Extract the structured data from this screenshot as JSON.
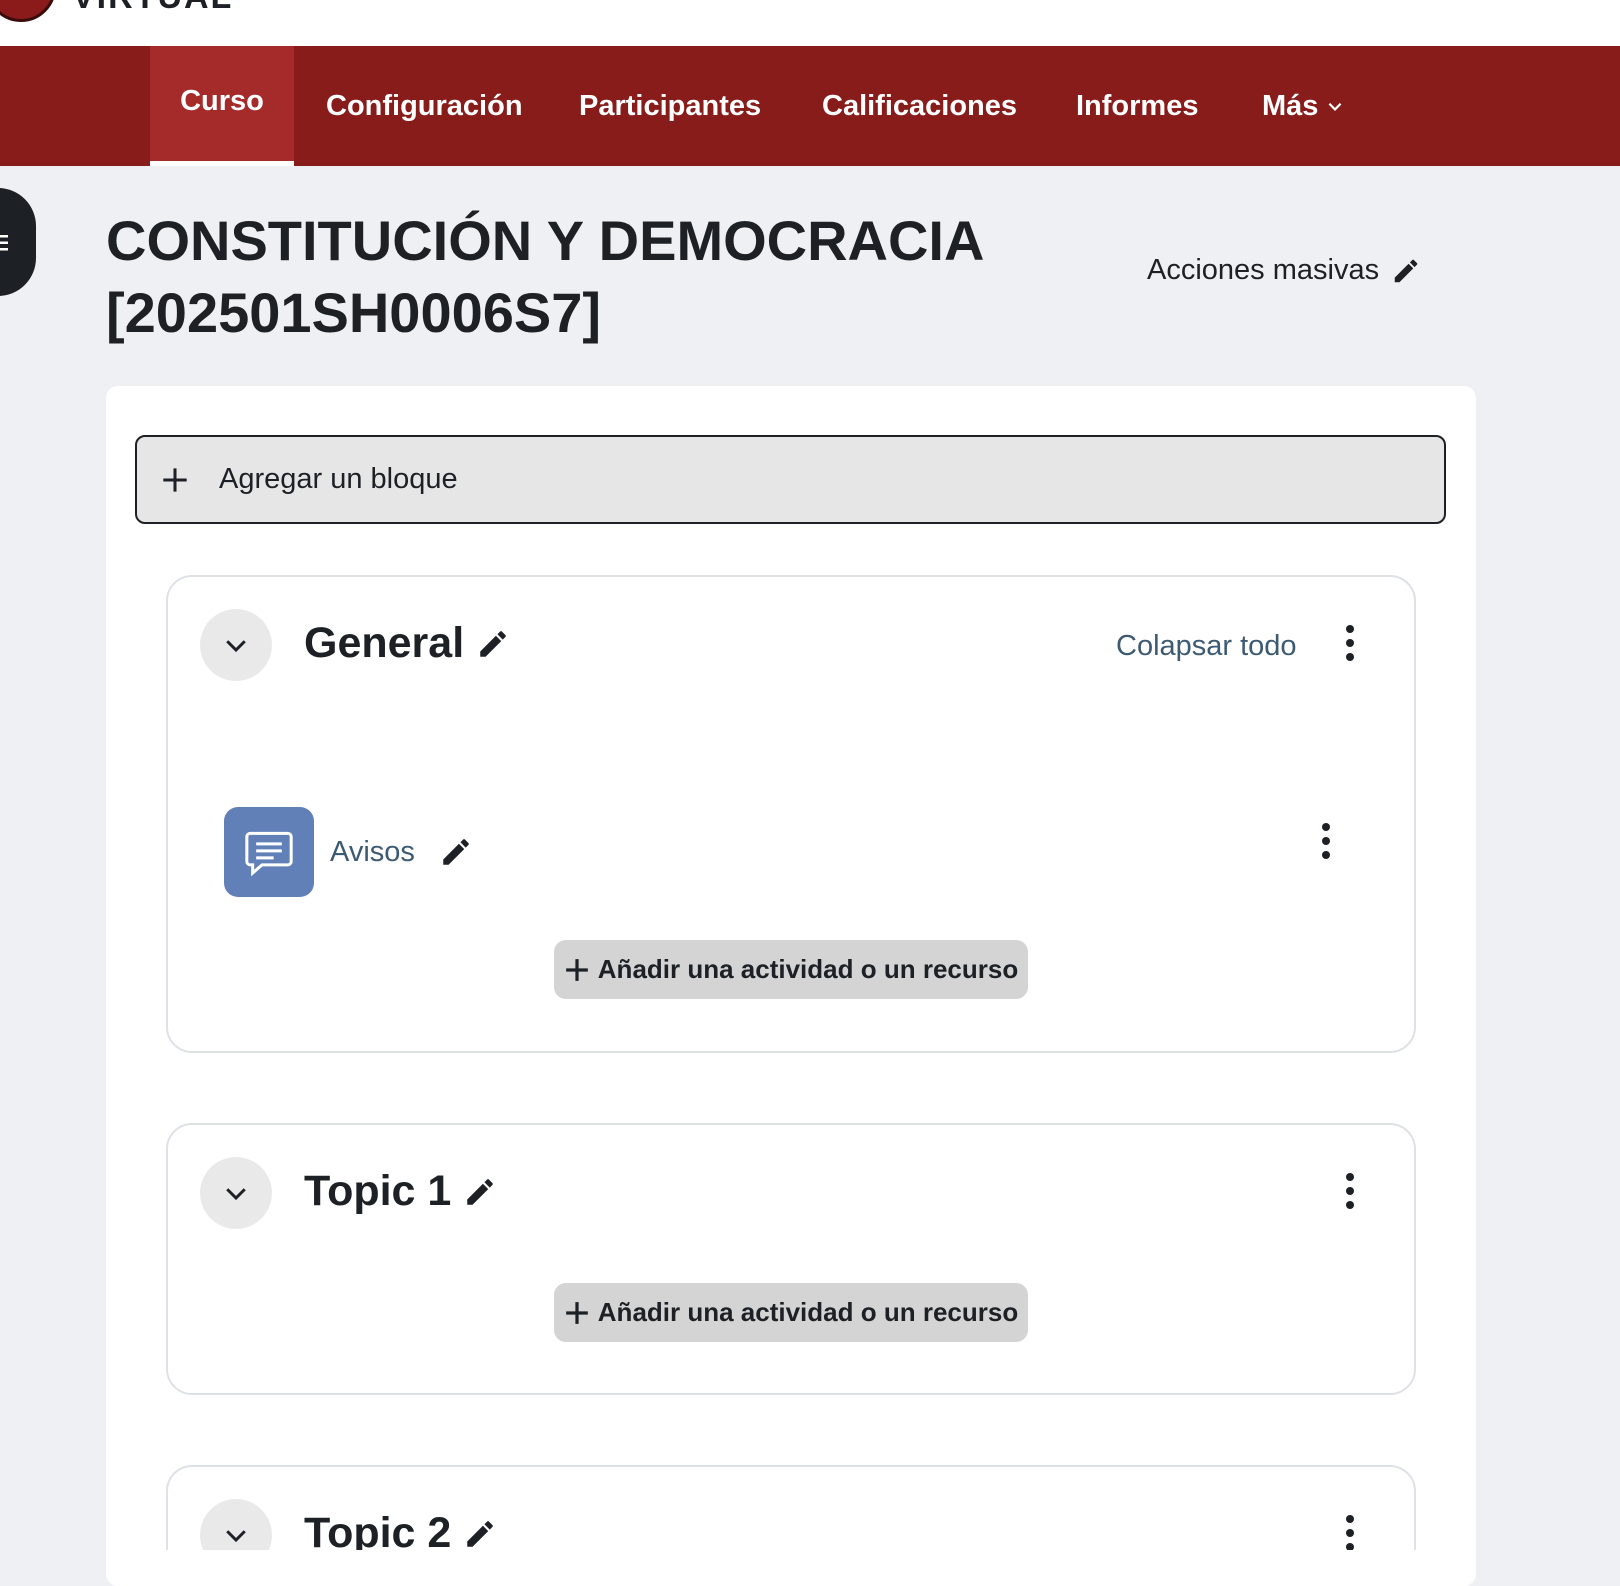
{
  "brand": {
    "logo_text": "VIRTUAL"
  },
  "nav": {
    "items": [
      {
        "label": "Curso",
        "active": true
      },
      {
        "label": "Configuración"
      },
      {
        "label": "Participantes"
      },
      {
        "label": "Calificaciones"
      },
      {
        "label": "Informes"
      },
      {
        "label": "Más"
      }
    ],
    "bg_color": "#881c1a",
    "active_color": "#a52a2a"
  },
  "page": {
    "title": "CONSTITUCIÓN Y DEMOCRACIA [202501SH0006S7]",
    "bulk_actions": "Acciones masivas"
  },
  "add_block": {
    "label": "Agregar un bloque"
  },
  "sections": [
    {
      "title": "General",
      "collapse_all": "Colapsar todo",
      "activities": [
        {
          "name": "Avisos",
          "icon": "forum-icon",
          "icon_color": "#6180b8"
        }
      ],
      "add_activity": "Añadir una actividad o un recurso"
    },
    {
      "title": "Topic 1",
      "add_activity": "Añadir una actividad o un recurso"
    },
    {
      "title": "Topic 2"
    }
  ]
}
